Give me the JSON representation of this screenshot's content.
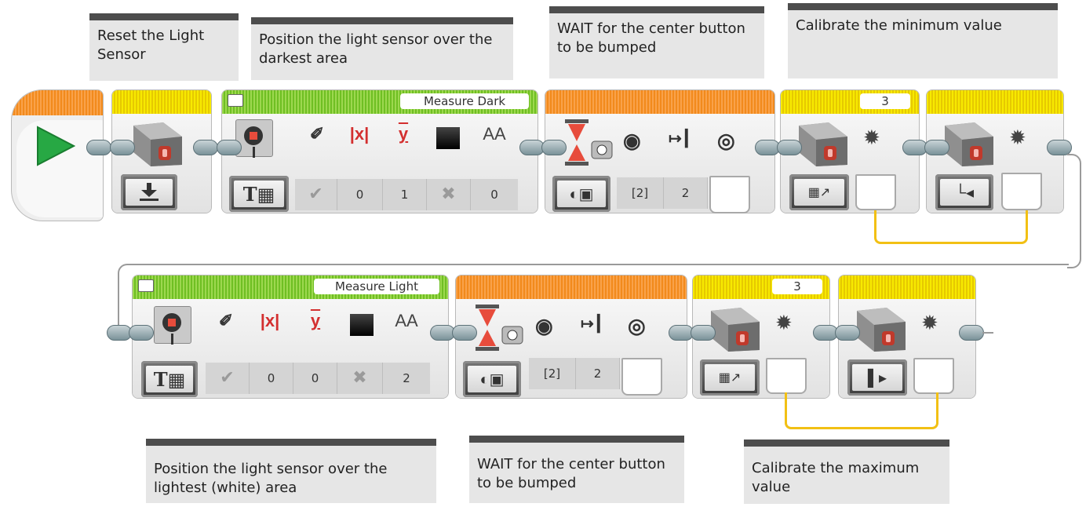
{
  "comments": {
    "reset": "Reset the Light Sensor",
    "position_dark": "Position the light sensor over the darkest area",
    "wait_top": "WAIT for the center button to be bumped",
    "calib_min": "Calibrate the minimum value",
    "position_light": "Position the light sensor over the lightest (white) area",
    "wait_bottom": "WAIT for the center button to be bumped",
    "calib_max": "Calibrate the maximum value"
  },
  "row1": {
    "display_label": "Measure Dark",
    "display_params": [
      "",
      "0",
      "1",
      "",
      "0"
    ],
    "wait_params": [
      "[2]",
      "2"
    ],
    "calib1_port": "3"
  },
  "row2": {
    "display_label": "Measure Light",
    "display_params": [
      "",
      "0",
      "0",
      "",
      "2"
    ],
    "wait_params": [
      "[2]",
      "2"
    ],
    "calib1_port": "3"
  },
  "colors": {
    "start_bar": "#f28a1c",
    "sensor_bar": "#e6c900",
    "display_bar": "#6fbf23",
    "wait_bar": "#f28a1c",
    "data_wire": "#f2c014",
    "play": "#27a844"
  }
}
